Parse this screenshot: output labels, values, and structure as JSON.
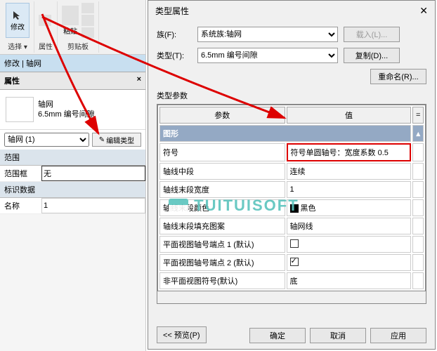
{
  "ribbon": {
    "modify_label": "修改",
    "select_label": "选择 ▾",
    "properties_label": "属性",
    "paste_label": "粘贴",
    "clipboard_label": "剪贴板"
  },
  "mod_header": "修改 | 轴网",
  "prop_header": "属性",
  "type": {
    "line1": "轴网",
    "line2": "6.5mm 编号间隙"
  },
  "instance": {
    "selector": "轴网 (1)",
    "edit_type_btn": "编辑类型"
  },
  "sections": {
    "extent": "范围",
    "extent_box": "范围框",
    "extent_val": "无",
    "ident": "标识数据",
    "name": "名称",
    "name_val": "1"
  },
  "dialog": {
    "title": "类型属性",
    "family_lbl": "族(F):",
    "family_val": "系统族:轴网",
    "type_lbl": "类型(T):",
    "type_val": "6.5mm 编号间隙",
    "load_btn": "载入(L)...",
    "dup_btn": "复制(D)...",
    "rename_btn": "重命名(R)...",
    "params_lbl": "类型参数",
    "col_param": "参数",
    "col_value": "值",
    "cat_graphics": "图形",
    "rows": [
      {
        "p": "符号",
        "v": "符号单圆轴号：宽度系数 0.5"
      },
      {
        "p": "轴线中段",
        "v": "连续"
      },
      {
        "p": "轴线末段宽度",
        "v": "1"
      },
      {
        "p": "轴线末段颜色",
        "v": "黑色"
      },
      {
        "p": "轴线末段填充图案",
        "v": "轴网线"
      },
      {
        "p": "平面视图轴号端点 1 (默认)",
        "v": ""
      },
      {
        "p": "平面视图轴号端点 2 (默认)",
        "v": ""
      },
      {
        "p": "非平面视图符号(默认)",
        "v": "底"
      }
    ],
    "preview_btn": "<< 预览(P)",
    "ok": "确定",
    "cancel": "取消",
    "apply": "应用"
  },
  "watermark": "TUITUISOFT"
}
